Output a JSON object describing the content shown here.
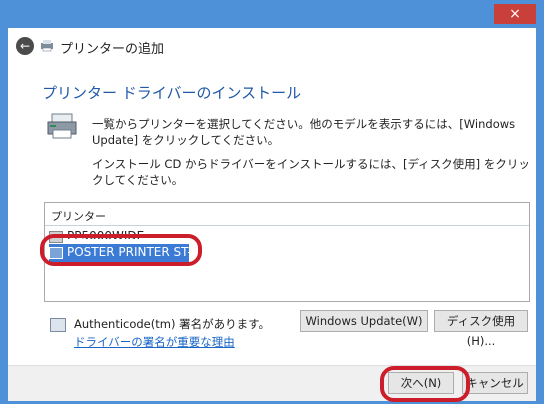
{
  "window": {
    "close_icon": "×",
    "header_title": "プリンターの追加",
    "back_icon": "←"
  },
  "content": {
    "heading": "プリンター ドライバーのインストール",
    "description1": "一覧からプリンターを選択してください。他のモデルを表示するには、[Windows Update] をクリックしてください。",
    "description2": "インストール CD からドライバーをインストールするには、[ディスク使用] をクリックしてください。",
    "list": {
      "header": "プリンター",
      "items": [
        {
          "label": "PP5000WIDE",
          "selected": false
        },
        {
          "label": "POSTER PRINTER ST-R",
          "selected": true
        }
      ]
    },
    "certificate_text": "Authenticode(tm) 署名があります。",
    "signature_link": "ドライバーの署名が重要な理由",
    "windows_update_button": "Windows Update(W)",
    "disk_button": "ディスク使用(H)..."
  },
  "footer": {
    "next_button": "次へ(N)",
    "cancel_button": "キャンセル"
  },
  "colors": {
    "accent": "#4f91d8",
    "selection": "#3b7bd5",
    "highlight_ring": "#cc1d2a",
    "heading": "#1f59a8",
    "link": "#1a66c7"
  }
}
